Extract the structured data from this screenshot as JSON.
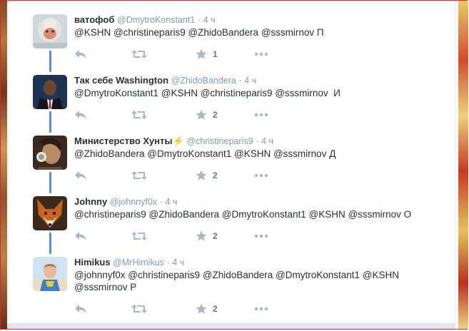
{
  "tweets": [
    {
      "name": "ватофоб",
      "handle": "@DmytroKonstant1",
      "time": "4 ч",
      "lines": [
        "@KSHN @christineparis9 @ZhidoBandera @sssmirnov П"
      ],
      "favorites": "1",
      "avatar": "monkey"
    },
    {
      "name": "Так себе Washington",
      "handle": "@ZhidoBandera",
      "time": "4 ч",
      "lines": [
        "@DmytroKonstant1 @KSHN @christineparis9 @sssmirnov  И"
      ],
      "favorites": "2",
      "avatar": "suit-man"
    },
    {
      "name": "Министерство Хунты⚡",
      "handle": "@christineparis9",
      "time": "4 ч",
      "lines": [
        "@ZhidoBandera @DmytroKonstant1 @KSHN @sssmirnov Д"
      ],
      "favorites": "2",
      "avatar": "headphones"
    },
    {
      "name": "Johnny",
      "handle": "@johnnyf0x",
      "time": "4 ч",
      "lines": [
        "@christineparis9 @ZhidoBandera @DmytroKonstant1 @KSHN @sssmirnov О"
      ],
      "favorites": "2",
      "avatar": "fox"
    },
    {
      "name": "Himikus",
      "handle": "@MrHimikus",
      "time": "4 ч",
      "lines": [
        "@johnnyf0x @christineparis9 @ZhidoBandera @DmytroKonstant1 @KSHN",
        "@sssmirnov Р"
      ],
      "favorites": "2",
      "avatar": "child"
    }
  ],
  "separator": "·",
  "colors": {
    "name": "#292f33",
    "meta": "#8899a6",
    "icon": "#aab8c2",
    "thread_line": "#5a8fc6",
    "frame_border": "#d9262b"
  },
  "icons": [
    "reply-icon",
    "retweet-icon",
    "favorite-star-icon",
    "more-dots-icon"
  ]
}
